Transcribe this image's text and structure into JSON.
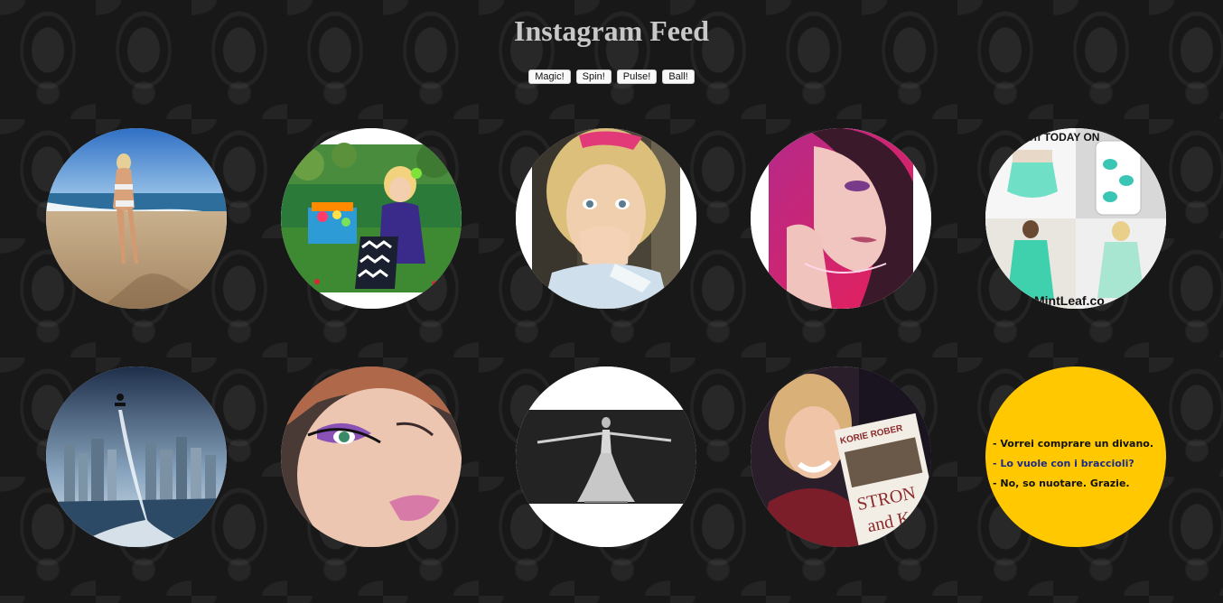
{
  "page": {
    "title": "Instagram Feed"
  },
  "buttons": [
    {
      "label": "Magic!"
    },
    {
      "label": "Spin!"
    },
    {
      "label": "Pulse!"
    },
    {
      "label": "Ball!"
    }
  ],
  "feed": {
    "items": [
      {
        "image": "woman-on-beach"
      },
      {
        "image": "girl-with-gift-box"
      },
      {
        "image": "girl-blowing-kiss"
      },
      {
        "image": "woman-pink-selfie"
      },
      {
        "image": "mint-dress-ad",
        "texts": [
          "% off TODAY ON",
          "MintLeaf.co"
        ]
      },
      {
        "image": "flyboard-city-skyline"
      },
      {
        "image": "makeup-closeup"
      },
      {
        "image": "ballet-dancer-stage"
      },
      {
        "image": "woman-with-book",
        "texts": [
          "KORIE ROBER",
          "STRON",
          "and K"
        ]
      },
      {
        "image": "yellow-text-quote",
        "texts": [
          "- Vorrei comprare un divano.",
          "- Lo vuole con i braccioli?",
          "- No, so nuotare. Grazie."
        ]
      }
    ]
  },
  "colors": {
    "quote_background": "#ffc800",
    "title_text": "#c8c8c8",
    "quote_blue": "#1c2a8c"
  }
}
